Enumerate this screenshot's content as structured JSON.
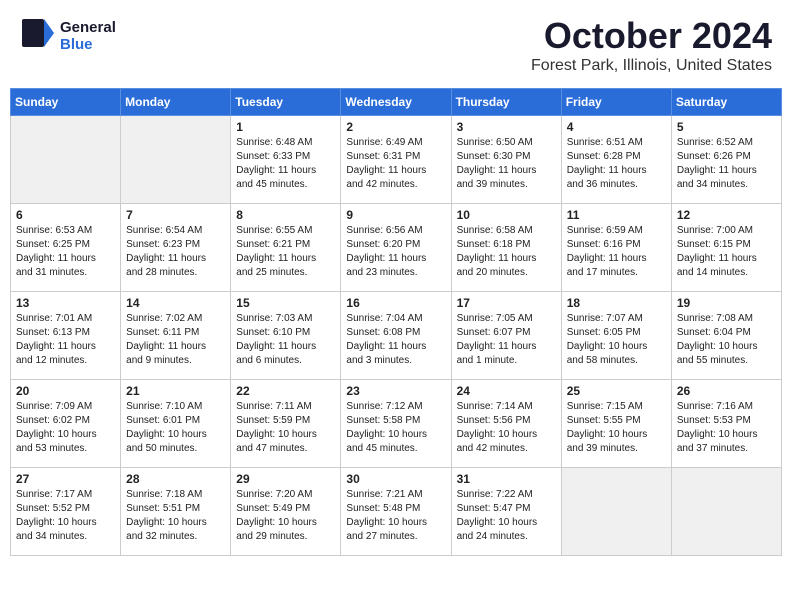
{
  "header": {
    "logo_general": "General",
    "logo_blue": "Blue",
    "title": "October 2024",
    "location": "Forest Park, Illinois, United States"
  },
  "days_of_week": [
    "Sunday",
    "Monday",
    "Tuesday",
    "Wednesday",
    "Thursday",
    "Friday",
    "Saturday"
  ],
  "weeks": [
    [
      {
        "day": "",
        "info": "",
        "empty": true
      },
      {
        "day": "",
        "info": "",
        "empty": true
      },
      {
        "day": "1",
        "info": "Sunrise: 6:48 AM\nSunset: 6:33 PM\nDaylight: 11 hours and 45 minutes.",
        "empty": false
      },
      {
        "day": "2",
        "info": "Sunrise: 6:49 AM\nSunset: 6:31 PM\nDaylight: 11 hours and 42 minutes.",
        "empty": false
      },
      {
        "day": "3",
        "info": "Sunrise: 6:50 AM\nSunset: 6:30 PM\nDaylight: 11 hours and 39 minutes.",
        "empty": false
      },
      {
        "day": "4",
        "info": "Sunrise: 6:51 AM\nSunset: 6:28 PM\nDaylight: 11 hours and 36 minutes.",
        "empty": false
      },
      {
        "day": "5",
        "info": "Sunrise: 6:52 AM\nSunset: 6:26 PM\nDaylight: 11 hours and 34 minutes.",
        "empty": false
      }
    ],
    [
      {
        "day": "6",
        "info": "Sunrise: 6:53 AM\nSunset: 6:25 PM\nDaylight: 11 hours and 31 minutes.",
        "empty": false
      },
      {
        "day": "7",
        "info": "Sunrise: 6:54 AM\nSunset: 6:23 PM\nDaylight: 11 hours and 28 minutes.",
        "empty": false
      },
      {
        "day": "8",
        "info": "Sunrise: 6:55 AM\nSunset: 6:21 PM\nDaylight: 11 hours and 25 minutes.",
        "empty": false
      },
      {
        "day": "9",
        "info": "Sunrise: 6:56 AM\nSunset: 6:20 PM\nDaylight: 11 hours and 23 minutes.",
        "empty": false
      },
      {
        "day": "10",
        "info": "Sunrise: 6:58 AM\nSunset: 6:18 PM\nDaylight: 11 hours and 20 minutes.",
        "empty": false
      },
      {
        "day": "11",
        "info": "Sunrise: 6:59 AM\nSunset: 6:16 PM\nDaylight: 11 hours and 17 minutes.",
        "empty": false
      },
      {
        "day": "12",
        "info": "Sunrise: 7:00 AM\nSunset: 6:15 PM\nDaylight: 11 hours and 14 minutes.",
        "empty": false
      }
    ],
    [
      {
        "day": "13",
        "info": "Sunrise: 7:01 AM\nSunset: 6:13 PM\nDaylight: 11 hours and 12 minutes.",
        "empty": false
      },
      {
        "day": "14",
        "info": "Sunrise: 7:02 AM\nSunset: 6:11 PM\nDaylight: 11 hours and 9 minutes.",
        "empty": false
      },
      {
        "day": "15",
        "info": "Sunrise: 7:03 AM\nSunset: 6:10 PM\nDaylight: 11 hours and 6 minutes.",
        "empty": false
      },
      {
        "day": "16",
        "info": "Sunrise: 7:04 AM\nSunset: 6:08 PM\nDaylight: 11 hours and 3 minutes.",
        "empty": false
      },
      {
        "day": "17",
        "info": "Sunrise: 7:05 AM\nSunset: 6:07 PM\nDaylight: 11 hours and 1 minute.",
        "empty": false
      },
      {
        "day": "18",
        "info": "Sunrise: 7:07 AM\nSunset: 6:05 PM\nDaylight: 10 hours and 58 minutes.",
        "empty": false
      },
      {
        "day": "19",
        "info": "Sunrise: 7:08 AM\nSunset: 6:04 PM\nDaylight: 10 hours and 55 minutes.",
        "empty": false
      }
    ],
    [
      {
        "day": "20",
        "info": "Sunrise: 7:09 AM\nSunset: 6:02 PM\nDaylight: 10 hours and 53 minutes.",
        "empty": false
      },
      {
        "day": "21",
        "info": "Sunrise: 7:10 AM\nSunset: 6:01 PM\nDaylight: 10 hours and 50 minutes.",
        "empty": false
      },
      {
        "day": "22",
        "info": "Sunrise: 7:11 AM\nSunset: 5:59 PM\nDaylight: 10 hours and 47 minutes.",
        "empty": false
      },
      {
        "day": "23",
        "info": "Sunrise: 7:12 AM\nSunset: 5:58 PM\nDaylight: 10 hours and 45 minutes.",
        "empty": false
      },
      {
        "day": "24",
        "info": "Sunrise: 7:14 AM\nSunset: 5:56 PM\nDaylight: 10 hours and 42 minutes.",
        "empty": false
      },
      {
        "day": "25",
        "info": "Sunrise: 7:15 AM\nSunset: 5:55 PM\nDaylight: 10 hours and 39 minutes.",
        "empty": false
      },
      {
        "day": "26",
        "info": "Sunrise: 7:16 AM\nSunset: 5:53 PM\nDaylight: 10 hours and 37 minutes.",
        "empty": false
      }
    ],
    [
      {
        "day": "27",
        "info": "Sunrise: 7:17 AM\nSunset: 5:52 PM\nDaylight: 10 hours and 34 minutes.",
        "empty": false
      },
      {
        "day": "28",
        "info": "Sunrise: 7:18 AM\nSunset: 5:51 PM\nDaylight: 10 hours and 32 minutes.",
        "empty": false
      },
      {
        "day": "29",
        "info": "Sunrise: 7:20 AM\nSunset: 5:49 PM\nDaylight: 10 hours and 29 minutes.",
        "empty": false
      },
      {
        "day": "30",
        "info": "Sunrise: 7:21 AM\nSunset: 5:48 PM\nDaylight: 10 hours and 27 minutes.",
        "empty": false
      },
      {
        "day": "31",
        "info": "Sunrise: 7:22 AM\nSunset: 5:47 PM\nDaylight: 10 hours and 24 minutes.",
        "empty": false
      },
      {
        "day": "",
        "info": "",
        "empty": true
      },
      {
        "day": "",
        "info": "",
        "empty": true
      }
    ]
  ]
}
